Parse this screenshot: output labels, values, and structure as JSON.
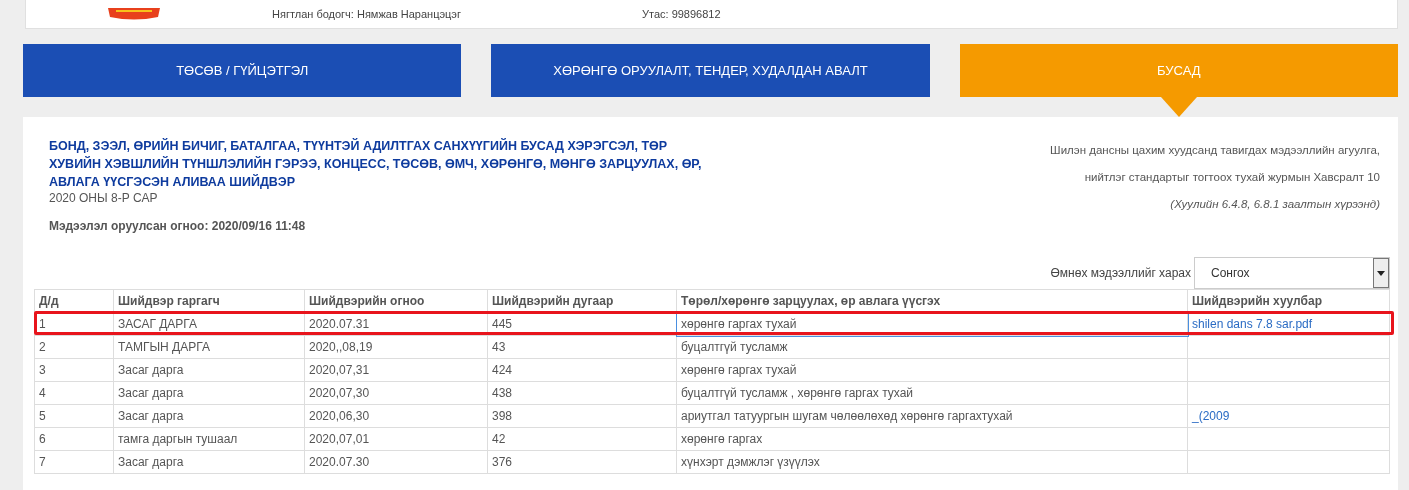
{
  "header": {
    "accountant": "Нягтлан бодогч: Нямжав Наранцэцэг",
    "phone": "Утас: 99896812"
  },
  "tabs": [
    {
      "label": "ТӨСӨВ / ГҮЙЦЭТГЭЛ",
      "selected": false
    },
    {
      "label": "ХӨРӨНГӨ ОРУУЛАЛТ, ТЕНДЕР, ХУДАЛДАН АВАЛТ",
      "selected": false
    },
    {
      "label": "БУСАД",
      "selected": true
    }
  ],
  "report": {
    "title": "БОНД, ЗЭЭЛ, ӨРИЙН БИЧИГ, БАТАЛГАА, ТҮҮНТЭЙ АДИЛТГАХ САНХҮҮГИЙН БУСАД ХЭРЭГСЭЛ, ТӨР ХУВИЙН ХЭВШЛИЙН ТҮНШЛЭЛИЙН ГЭРЭЭ, КОНЦЕСС, ТӨСӨВ, ӨМЧ, ХӨРӨНГӨ, МӨНГӨ ЗАРЦУУЛАХ, ӨР, АВЛАГА ҮҮСГЭСЭН АЛИВАА ШИЙДВЭР",
    "period": "2020 ОНЫ 8-Р САР",
    "posted": "Мэдээлэл оруулсан огноо: 2020/09/16 11:48",
    "note_lines": [
      "Шилэн дансны цахим хуудсанд тавигдах мэдээллийн агуулга,",
      "нийтлэг стандартыг тогтоох тухай журмын Хавсралт 10"
    ],
    "note_ref": "(Хуулийн 6.4.8, 6.8.1 заалтын хүрээнд)"
  },
  "history": {
    "label": "Өмнөх мэдээллийг харах",
    "value": "Сонгох"
  },
  "table": {
    "columns": [
      "Д/д",
      "Шийдвэр гаргагч",
      "Шийдвэрийн огноо",
      "Шийдвэрийн дугаар",
      "Төрөл/хөрөнгө зарцуулах, өр авлага үүсгэх",
      "Шийдвэрийн хуулбар"
    ],
    "rows": [
      {
        "cells": [
          "1",
          "ЗАСАГ ДАРГА",
          "2020.07.31",
          "445",
          "хөрөнгө гаргах тухай"
        ],
        "file": "shilen dans 7.8 sar.pdf",
        "marked": true
      },
      {
        "cells": [
          "2",
          "ТАМГЫН ДАРГА",
          "2020,,08,19",
          "43",
          "буцалтгүй тусламж"
        ],
        "marked": false
      },
      {
        "cells": [
          "3",
          "Засаг дарга",
          "2020,07,31",
          "424",
          "хөрөнгө гаргах тухай"
        ],
        "marked": false
      },
      {
        "cells": [
          "4",
          "Засаг дарга",
          "2020,07,30",
          "438",
          "буцалтгүй тусламж , хөрөнгө гаргах тухай"
        ],
        "marked": false
      },
      {
        "cells": [
          "5",
          "Засаг дарга",
          "2020,06,30",
          "398",
          "ариутгал татуургын шугам чөлөөлөхөд хөрөнгө гаргахтухай"
        ],
        "file": "_(2009",
        "marked": false
      },
      {
        "cells": [
          "6",
          "тамга даргын тушаал",
          "2020,07,01",
          "42",
          "хөрөнгө гаргах"
        ],
        "marked": false
      },
      {
        "cells": [
          "7",
          "Засаг дарга",
          "2020.07.30",
          "376",
          "хүнхэрт дэмжлэг үзүүлэх"
        ],
        "marked": false
      }
    ]
  }
}
